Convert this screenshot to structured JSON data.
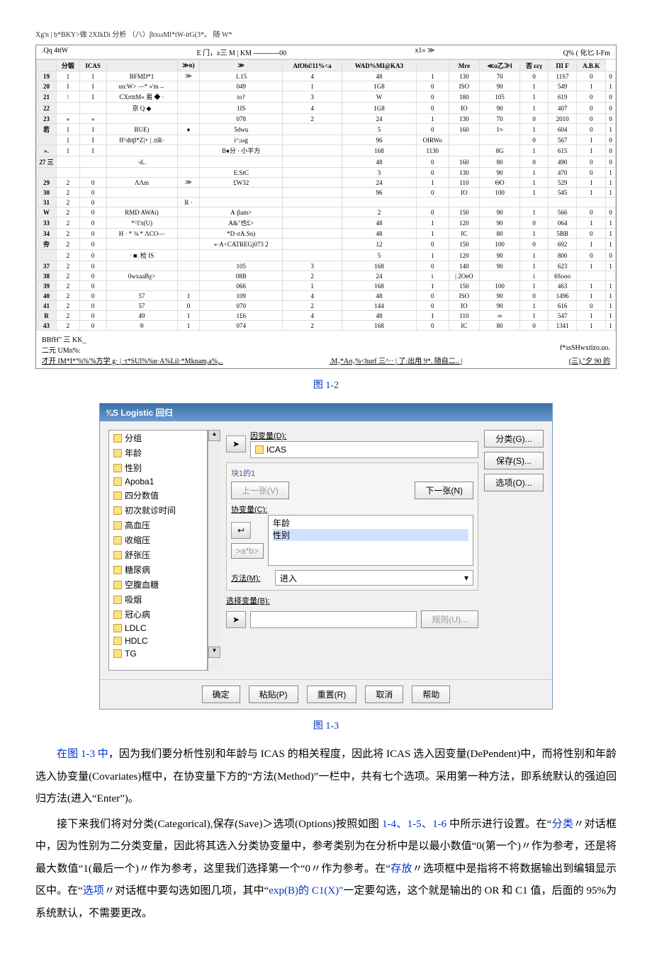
{
  "title_line": "Xg'n | b*BKY>做 2XIkDi 分析 （八）βtxωMl*tW-itG(3*。 随 W*",
  "spss_top": {
    "left": ".Qq 4ttW",
    "menu": "E 门，z三 M | KM -----------00",
    "right": "x1» ≫",
    "far_right": "Q% ( 化匕 I-Fm"
  },
  "headers": [
    "",
    "分锻",
    "ICAS",
    "",
    "≫n)",
    "≫",
    "AfObi!11%<a",
    "WAD%MI@KA3",
    "",
    "Mre",
    "≪α乙≫l",
    "否 εεγ",
    "ΠI F",
    "A.B.K"
  ],
  "rows": [
    [
      "19",
      "1",
      "1",
      "BFMD*1",
      "≫",
      "1.15",
      "4",
      "48",
      "1",
      "130",
      "70",
      "0",
      "11S7",
      "0",
      "0"
    ],
    [
      "20",
      "I",
      "I",
      "un:W> —* «'m→",
      "",
      "049",
      "1",
      "1G8",
      "0",
      "ISO",
      "90",
      "1",
      "549",
      "1",
      "1"
    ],
    [
      "21",
      "\\",
      "I",
      "CXrtttM« 易 ◆ ·",
      "",
      "to?",
      "3",
      "W",
      "0",
      "180",
      "105",
      "1",
      "619",
      "0",
      "0"
    ],
    [
      "22",
      "",
      "",
      "京 Q ◆",
      "",
      "1IS",
      "4",
      "1G8",
      "0",
      "IO",
      "90",
      "1",
      "407",
      "0",
      "0"
    ],
    [
      "23",
      "«",
      "«",
      "",
      "",
      "078",
      "2",
      "24",
      "1",
      "130",
      "70",
      "0",
      "2010",
      "0",
      "0"
    ],
    [
      "若",
      "1",
      "1",
      "BUE)",
      "♦",
      "5dwu",
      "",
      "5",
      "0",
      "160",
      "1≈",
      "1",
      "604",
      "0",
      "1"
    ],
    [
      "",
      "1",
      "I",
      "ff^dttβ*Z|+ | .ttR·",
      "",
      "i^;ωg",
      "",
      "96",
      "OIRWo",
      "",
      "",
      "0",
      "567",
      "1",
      "0"
    ],
    [
      "».",
      "1",
      "I",
      "",
      "",
      "B♦分 · 小平方",
      "",
      "168",
      "1130",
      "",
      "8G",
      "1",
      "615",
      "1",
      "0"
    ],
    [
      "27 三",
      "",
      "",
      "·d..",
      "",
      "",
      "",
      "48",
      "0",
      "160",
      "80",
      "0",
      "490",
      "0",
      "0"
    ],
    [
      "",
      "",
      "",
      "",
      "",
      "E.StC",
      "",
      "3",
      "0",
      "130",
      "90",
      "1",
      "470",
      "0",
      "1"
    ],
    [
      "29",
      "2",
      "0",
      "ΛΛm",
      "≫",
      "£W32",
      "",
      "24",
      "1",
      "110",
      "ΘO",
      "1",
      "529",
      "1",
      "1"
    ],
    [
      "30",
      "2",
      "0",
      "",
      "",
      "",
      "",
      "96",
      "0",
      "IO",
      "100",
      "1",
      "545",
      "1",
      "1"
    ],
    [
      "31",
      "2",
      "0",
      "",
      "R ·",
      "",
      "",
      "",
      "",
      "",
      "",
      "",
      "",
      "",
      ""
    ],
    [
      "W",
      "2",
      "0",
      "RMD AWAi)",
      "",
      "A·βam>",
      "",
      "2",
      "0",
      "150",
      "90",
      "1",
      "566",
      "0",
      "0"
    ],
    [
      "33",
      "2",
      "0",
      "*^l'π(U)",
      "",
      "A&\"也£>",
      "",
      "48",
      "1",
      "120",
      "90",
      "0",
      "064",
      "1",
      "1"
    ],
    [
      "34",
      "2",
      "0",
      "H · * ⅜ * ΛCO—",
      "",
      "*D·σA.Sn)",
      "",
      "48",
      "1",
      "IC",
      "80",
      "1",
      "5BB",
      "0",
      "1"
    ],
    [
      "夯",
      "2",
      "0",
      "",
      "",
      "»·A<CATREGj073 2",
      "",
      "12",
      "0",
      "150",
      "100",
      "0",
      "692",
      "1",
      "1"
    ],
    [
      "",
      "2",
      "0",
      " · ■. 检 IS",
      "",
      "",
      "",
      "5",
      "1",
      "120",
      "90",
      "1",
      "800",
      "0",
      "0"
    ],
    [
      "37",
      "2",
      "0",
      "",
      "",
      "105",
      "3",
      "168",
      "0",
      "140",
      "90",
      "1",
      "623",
      "1",
      "1"
    ],
    [
      "38",
      "2",
      "0",
      "0wxaaBχ>",
      "",
      "08B",
      "2",
      "24",
      "i",
      "| 2OeO",
      "",
      "i",
      "6Sooo",
      "",
      ""
    ],
    [
      "39",
      "2",
      "0",
      "",
      "",
      "066",
      "1",
      "168",
      "1",
      "150",
      "100",
      "1",
      "463",
      "1",
      "1"
    ],
    [
      "40",
      "2",
      "0",
      "57",
      "1",
      "109",
      "4",
      "48",
      "0",
      "ISO",
      "90",
      "0",
      "1496",
      "1",
      "1"
    ],
    [
      "41",
      "2",
      "0",
      "57",
      "0",
      "070",
      "2",
      "144",
      "0",
      "IO",
      "90",
      "1",
      "616",
      "0",
      "1"
    ],
    [
      "R",
      "2",
      "0",
      "49",
      "1",
      "1£6",
      "4",
      "48",
      "1",
      "110",
      "∞",
      "1",
      "547",
      "1",
      "1"
    ],
    [
      "43",
      "2",
      "0",
      "®",
      "1",
      "074",
      "2",
      "168",
      "0",
      "IC",
      "80",
      "0",
      "1341",
      "1",
      "1"
    ]
  ],
  "spss_bottom": {
    "l1": "BBfH\" 三 KK_",
    "l2": "二元 UMn%:",
    "r2": "f*ssSHwxtlzo.uo.",
    "l3": "才开 IM*I*'%%'%方学 g· | ·t*SUl%%n·A%Lil·*Mknam,a%,..",
    "m3": ".M₃*Aσ₅%<hurf 三^·· | 了:出用 9*. 随自二.. |",
    "r3": "(三),\"夕 90 的"
  },
  "caption1": "图 1-2",
  "dialog": {
    "title": "¾S Logistic 回归",
    "vars": [
      "分组",
      "年龄",
      "性别",
      "Apoba1",
      "四分数值",
      "初次就诊时间",
      "高血压",
      "收缩压",
      "舒张压",
      "糖尿病",
      "空腹血糖",
      "吸烟",
      "冠心病",
      "LDLC",
      "HDLC",
      "TG"
    ],
    "dep_label": "因变量(D):",
    "dep_value": "ICAS",
    "block_title": "块1的1",
    "prev": "上一张(V)",
    "next": "下一张(N)",
    "cov_label": "协变量(C):",
    "cov_items": [
      "年龄",
      "性别"
    ],
    "intbtn": ">a*b>",
    "method_label": "方法(M):",
    "method_value": "进入",
    "selvar_label": "选择变量(B):",
    "rule": "规则(U)...",
    "side": {
      "cat": "分类(G)...",
      "save": "保存(S)...",
      "opt": "选项(O)..."
    },
    "buttons": {
      "ok": "确定",
      "paste": "粘贴(P)",
      "reset": "重置(R)",
      "cancel": "取消",
      "help": "帮助"
    }
  },
  "caption2": "图 1-3",
  "para1": {
    "a": "在图 1-3 中",
    "b": "，因为我们要分析性别和年龄与 ICAS 的相关程度，因此将 ICAS 选入因变量(DePendent)中，而将性别和年龄选入协变量(Covariates)框中，在协变量下方的“方法(Method)”一栏中，共有七个选项。采用第一种方法，即系统默认的强迫回归方法(进入“Enter”)。"
  },
  "para2": {
    "a": "接下来我们将对分类(Categorical),保存(Save)＞选项(Options)按照如图 ",
    "b": "1-4、1-5、1-6",
    "c": " 中所示进行设置。在“",
    "d": "分类",
    "e": "〃对话框中，因为性别为二分类变量，因此将其选入分类协变量中，参考类别为在分析中是以最小数值“0(第一个)〃作为参考，还是将最大数值“1(最后一个)〃作为参考，这里我们选择第一个“0〃作为参考。在“",
    "f": "存放",
    "g": "〃选项框中是指将不将数据输出到编辑显示区中。在“",
    "h": "选项",
    "i": "〃对话框中要勾选如图几项，其中“",
    "j": "exp(B)的 C1(X)\"",
    "k": "一定要勾选，这个就是输出的 OR 和 C1 值，后面的 95%为系统默认，不需要更改。"
  }
}
